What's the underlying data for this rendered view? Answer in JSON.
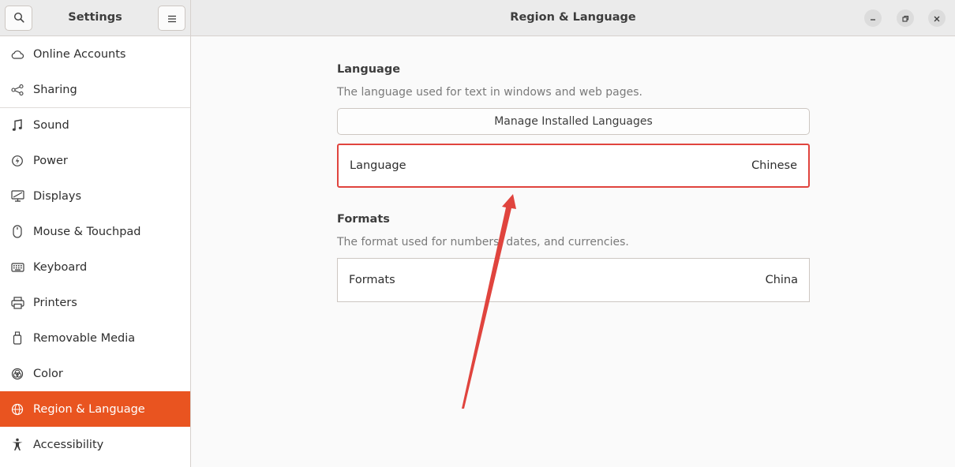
{
  "sidebar": {
    "title": "Settings",
    "items": [
      {
        "label": "Online Accounts",
        "icon": "cloud-icon"
      },
      {
        "label": "Sharing",
        "icon": "share-icon"
      },
      {
        "label": "Sound",
        "icon": "music-note-icon"
      },
      {
        "label": "Power",
        "icon": "power-icon"
      },
      {
        "label": "Displays",
        "icon": "display-icon"
      },
      {
        "label": "Mouse & Touchpad",
        "icon": "mouse-icon"
      },
      {
        "label": "Keyboard",
        "icon": "keyboard-icon"
      },
      {
        "label": "Printers",
        "icon": "printer-icon"
      },
      {
        "label": "Removable Media",
        "icon": "usb-drive-icon"
      },
      {
        "label": "Color",
        "icon": "color-icon"
      },
      {
        "label": "Region & Language",
        "icon": "globe-icon",
        "selected": true
      },
      {
        "label": "Accessibility",
        "icon": "accessibility-icon"
      }
    ]
  },
  "header": {
    "title": "Region & Language"
  },
  "language_section": {
    "title": "Language",
    "description": "The language used for text in windows and web pages.",
    "manage_button": "Manage Installed Languages",
    "row_label": "Language",
    "row_value": "Chinese"
  },
  "formats_section": {
    "title": "Formats",
    "description": "The format used for numbers, dates, and currencies.",
    "row_label": "Formats",
    "row_value": "China"
  },
  "colors": {
    "accent": "#e95420",
    "annotation": "#e0443e"
  }
}
